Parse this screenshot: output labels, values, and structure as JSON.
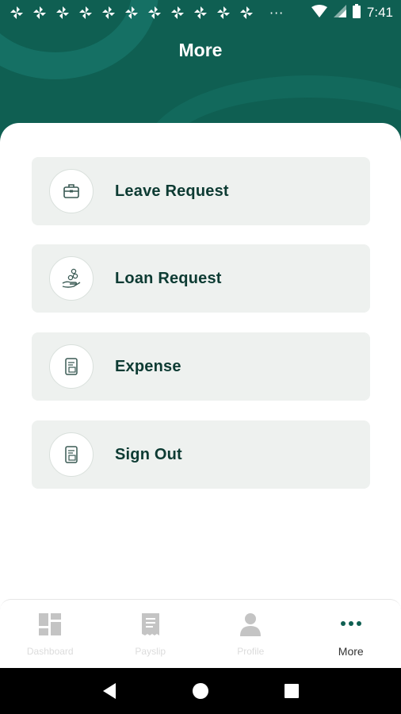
{
  "status_bar": {
    "time": "7:41",
    "overflow": "···",
    "notification_icon_count": 11
  },
  "header": {
    "title": "More"
  },
  "menu": {
    "items": [
      {
        "label": "Leave Request",
        "icon": "briefcase-icon"
      },
      {
        "label": "Loan Request",
        "icon": "coins-hand-icon"
      },
      {
        "label": "Expense",
        "icon": "receipt-icon"
      },
      {
        "label": "Sign Out",
        "icon": "receipt-icon"
      }
    ]
  },
  "bottom_nav": {
    "tabs": [
      {
        "label": "Dashboard",
        "icon": "dashboard-icon",
        "active": false
      },
      {
        "label": "Payslip",
        "icon": "payslip-icon",
        "active": false
      },
      {
        "label": "Profile",
        "icon": "profile-icon",
        "active": false
      },
      {
        "label": "More",
        "icon": "more-dots-icon",
        "active": true
      }
    ]
  },
  "colors": {
    "header_bg": "#0f5f52",
    "menu_bg": "#eef1ef",
    "menu_text": "#0d3b33",
    "accent": "#0f5f52"
  }
}
